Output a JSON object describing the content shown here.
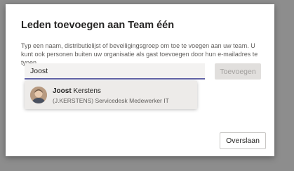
{
  "dialog": {
    "title": "Leden toevoegen aan Team één",
    "description": "Typ een naam, distributielijst of beveiligingsgroep om toe te voegen aan uw team. U kunt ook personen buiten uw organisatie als gast toevoegen door hun e-mailadres te typen."
  },
  "search": {
    "value": "Joost",
    "placeholder": ""
  },
  "buttons": {
    "add_label": "Toevoegen",
    "skip_label": "Overslaan"
  },
  "suggestions": [
    {
      "first_name": "Joost",
      "last_name": " Kerstens",
      "detail": "(J.KERSTENS) Servicedesk Medewerker IT"
    }
  ],
  "colors": {
    "accent": "#6264a7",
    "disabled_button": "#e1dfdd",
    "highlight": "#edebe9"
  }
}
